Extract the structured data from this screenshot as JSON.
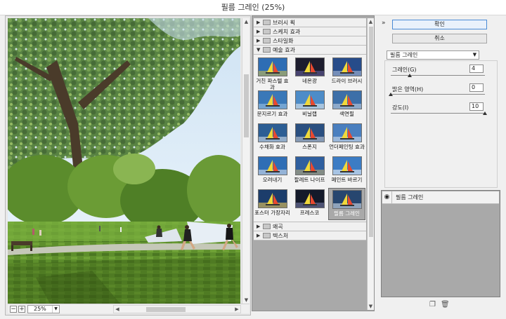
{
  "window": {
    "title": "필름 그레인 (25%)"
  },
  "preview": {
    "zoom": "25%"
  },
  "gallery": {
    "categories": {
      "brush": "브러시 획",
      "sketch": "스케치 효과",
      "stylize": "스타일화",
      "artistic": "예술 효과",
      "distort": "왜곡",
      "texture": "텍스처"
    },
    "artistic_filters": [
      "거친 파스텔 효과",
      "네온광",
      "드라이 브러시",
      "문지르기 효과",
      "비닐랩",
      "색연필",
      "수채화 효과",
      "스폰지",
      "언더페인팅 효과",
      "오려내기",
      "팔레트 나이프",
      "페인트 바르기",
      "포스터 가장자리",
      "프레스코",
      "필름 그레인"
    ],
    "selected": "필름 그레인"
  },
  "controls": {
    "collapse_icon": "»",
    "ok_label": "확인",
    "cancel_label": "취소",
    "filter_select": "필름 그레인",
    "grain_label": "그레인(G)",
    "grain_value": "4",
    "highlight_label": "밝은 영역(H)",
    "highlight_value": "0",
    "intensity_label": "강도(I)",
    "intensity_value": "10",
    "grain_level": 0.2,
    "highlight_level": 0.0,
    "intensity_level": 1.0
  },
  "layers": {
    "items": [
      {
        "name": "필름 그레인",
        "visible": true
      }
    ]
  },
  "colors": {
    "accent": "#4a8bd6",
    "panel_dark": "#a9a9a9"
  }
}
